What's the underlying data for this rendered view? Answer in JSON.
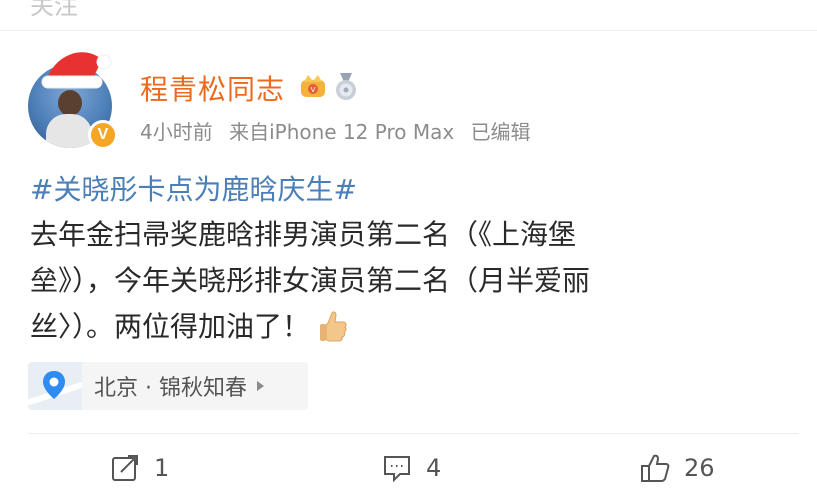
{
  "top_partial_text": "关注",
  "post": {
    "author": {
      "name": "程青松同志",
      "verified_badge": "V"
    },
    "meta": {
      "time": "4小时前",
      "source": "来自iPhone 12 Pro Max",
      "edited": "已编辑"
    },
    "topic": "#关晓彤卡点为鹿晗庆生#",
    "body_lines": [
      "去年金扫帚奖鹿晗排男演员第二名（《上海堡",
      "垒》），今年关晓彤排女演员第二名（月半爱丽",
      "丝〉）。两位得加油了！"
    ],
    "location": "北京 · 锦秋知春",
    "actions": {
      "repost_count": "1",
      "comment_count": "4",
      "like_count": "26"
    }
  },
  "colors": {
    "username": "#ec6a1f",
    "topic_link": "#4a7fb8",
    "meta_gray": "#8c8c8c",
    "badge": "#f5a623"
  },
  "icons": [
    "santa-hat-icon",
    "verified-v-icon",
    "crown-icon",
    "medal-icon",
    "thumbs-up-emoji-icon",
    "location-pin-icon",
    "chevron-right-icon",
    "repost-icon",
    "comment-icon",
    "like-icon"
  ]
}
